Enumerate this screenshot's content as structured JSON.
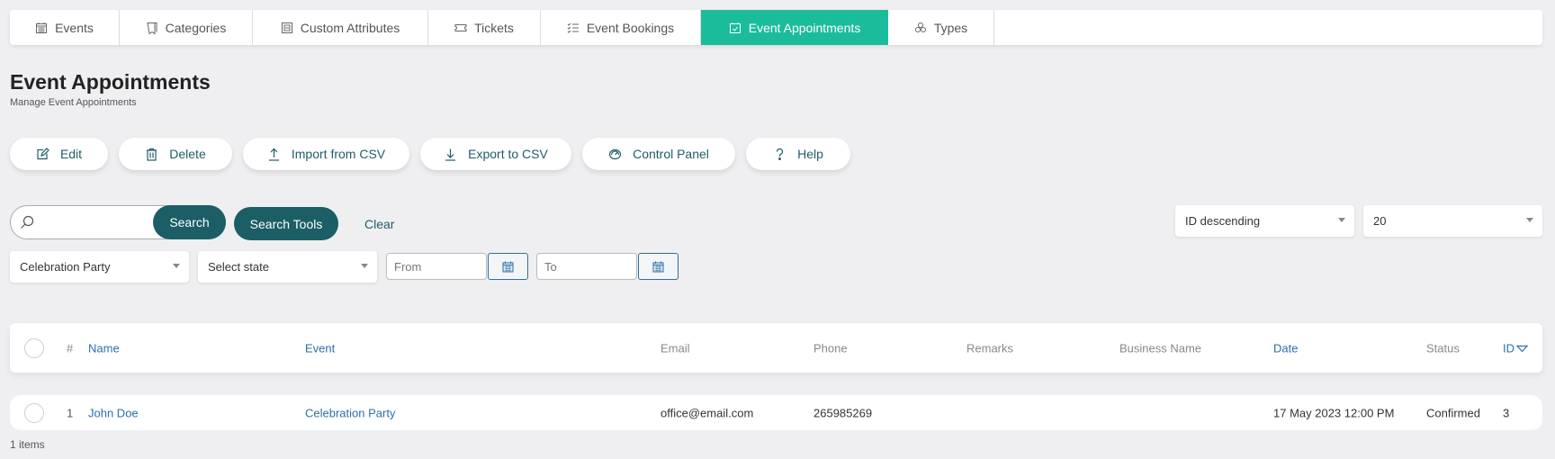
{
  "tabs": [
    {
      "label": "Events",
      "icon": "calendar-icon",
      "active": false
    },
    {
      "label": "Categories",
      "icon": "folder-icon",
      "active": false
    },
    {
      "label": "Custom Attributes",
      "icon": "attributes-icon",
      "active": false
    },
    {
      "label": "Tickets",
      "icon": "ticket-icon",
      "active": false
    },
    {
      "label": "Event Bookings",
      "icon": "checklist-icon",
      "active": false
    },
    {
      "label": "Event Appointments",
      "icon": "calendar-check-icon",
      "active": true
    },
    {
      "label": "Types",
      "icon": "cubes-icon",
      "active": false
    }
  ],
  "header": {
    "title": "Event Appointments",
    "subtitle": "Manage Event Appointments"
  },
  "toolbar": {
    "edit": "Edit",
    "delete": "Delete",
    "import": "Import from CSV",
    "export": "Export to CSV",
    "control_panel": "Control Panel",
    "help": "Help"
  },
  "search": {
    "value": "",
    "placeholder": "",
    "search_label": "Search",
    "search_tools_label": "Search Tools",
    "clear_label": "Clear"
  },
  "filters": {
    "event": "Celebration Party",
    "state": "Select state",
    "from_placeholder": "From",
    "to_placeholder": "To",
    "ordering": "ID descending",
    "limit": "20"
  },
  "table": {
    "columns": {
      "num": "#",
      "name": "Name",
      "event": "Event",
      "email": "Email",
      "phone": "Phone",
      "remarks": "Remarks",
      "business_name": "Business Name",
      "date": "Date",
      "status": "Status",
      "id": "ID"
    },
    "rows": [
      {
        "num": "1",
        "name": "John Doe",
        "event": "Celebration Party",
        "email": "office@email.com",
        "phone": "265985269",
        "remarks": "",
        "business_name": "",
        "date": "17 May 2023 12:00 PM",
        "status": "Confirmed",
        "id": "3"
      }
    ]
  },
  "footer": {
    "items_count": "1 items"
  },
  "colors": {
    "accent": "#1abc9c",
    "button_dark": "#1b5e66",
    "link": "#2a6fb0"
  }
}
